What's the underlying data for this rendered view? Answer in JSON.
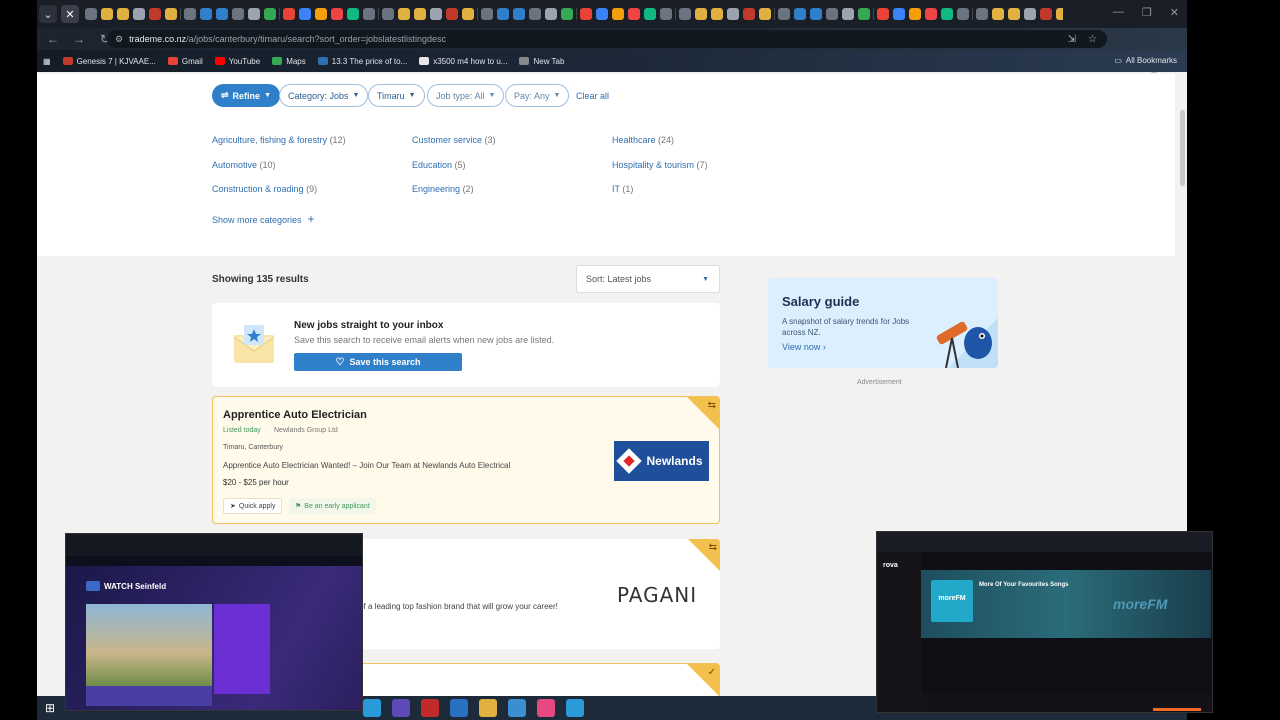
{
  "browser": {
    "url_host": "trademe.co.nz",
    "url_path": "/a/jobs/canterbury/timaru/search?sort_order=jobslatestlistingdesc",
    "bookmarks": [
      {
        "label": "Genesis 7 | KJVAAE...",
        "color": "#c0392b"
      },
      {
        "label": "Gmail",
        "color": "#e84335"
      },
      {
        "label": "YouTube",
        "color": "#ff0000"
      },
      {
        "label": "Maps",
        "color": "#34a853"
      },
      {
        "label": "13.3 The price of to...",
        "color": "#2d6fb0"
      },
      {
        "label": "x3500 m4 how to u...",
        "color": "#e6e6e6"
      },
      {
        "label": "New Tab",
        "color": "#888888"
      }
    ],
    "all_bookmarks": "All Bookmarks"
  },
  "filters": {
    "refine": "Refine",
    "category": "Category: Jobs",
    "location": "Timaru",
    "job_type": "Job type: All",
    "pay": "Pay: Any",
    "clear_all": "Clear all"
  },
  "categories": [
    {
      "name": "Agriculture, fishing & forestry",
      "count": "(12)"
    },
    {
      "name": "Automotive",
      "count": "(10)"
    },
    {
      "name": "Construction & roading",
      "count": "(9)"
    },
    {
      "name": "Customer service",
      "count": "(3)"
    },
    {
      "name": "Education",
      "count": "(5)"
    },
    {
      "name": "Engineering",
      "count": "(2)"
    },
    {
      "name": "Healthcare",
      "count": "(24)"
    },
    {
      "name": "Hospitality & tourism",
      "count": "(7)"
    },
    {
      "name": "IT",
      "count": "(1)"
    }
  ],
  "show_more": "Show more categories",
  "results": {
    "count_text": "Showing 135 results",
    "sort": "Sort: Latest jobs"
  },
  "alert": {
    "title": "New jobs straight to your inbox",
    "subtitle": "Save this search to receive email alerts when new jobs are listed.",
    "button": "Save this search"
  },
  "jobs": [
    {
      "title": "Apprentice Auto Electrician",
      "listed": "Listed today",
      "company": "Newlands Group Ltd",
      "location": "Timaru, Canterbury",
      "description": "Apprentice Auto Electrician Wanted! – Join Our Team at Newlands Auto Electrical",
      "pay": "$20 - $25 per hour",
      "quick_apply": "Quick apply",
      "early": "Be an early applicant",
      "logo_text": "Newlands"
    },
    {
      "description": "rt of a leading top fashion brand that will grow your career!",
      "logo_text": "PAGANI"
    }
  ],
  "sidebar": {
    "salary_title": "Salary guide",
    "salary_sub": "A snapshot of salary trends for Jobs across NZ.",
    "salary_link": "View now",
    "advert": "Advertisement"
  },
  "pip_left": {
    "title": "WATCH Seinfeld"
  },
  "pip_right": {
    "logo": "rova",
    "song": "More Of Your Favourites Songs",
    "art_text": "moreFM",
    "brand": "moreFM"
  },
  "colors": {
    "accent": "#2f7fc9",
    "featured_border": "#f0c15c",
    "listed_green": "#3f9a5d"
  }
}
